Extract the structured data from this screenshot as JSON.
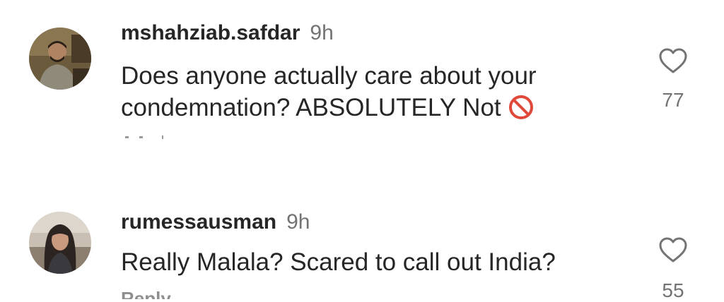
{
  "comments": [
    {
      "username": "mshahziab.safdar",
      "time": "9h",
      "text_main": "Does anyone actually care about your",
      "text_second": "condemnation? ABSOLUTELY Not",
      "emoji": "no-entry-sign",
      "likes": "77",
      "reply_label": "Reply"
    },
    {
      "username": "rumessausman",
      "time": "9h",
      "text_main": "Really Malala? Scared to call out India?",
      "likes": "55",
      "reply_label": "Reply"
    }
  ],
  "colors": {
    "text": "#262626",
    "secondary": "#737373",
    "emoji_red": "#e0483a"
  }
}
